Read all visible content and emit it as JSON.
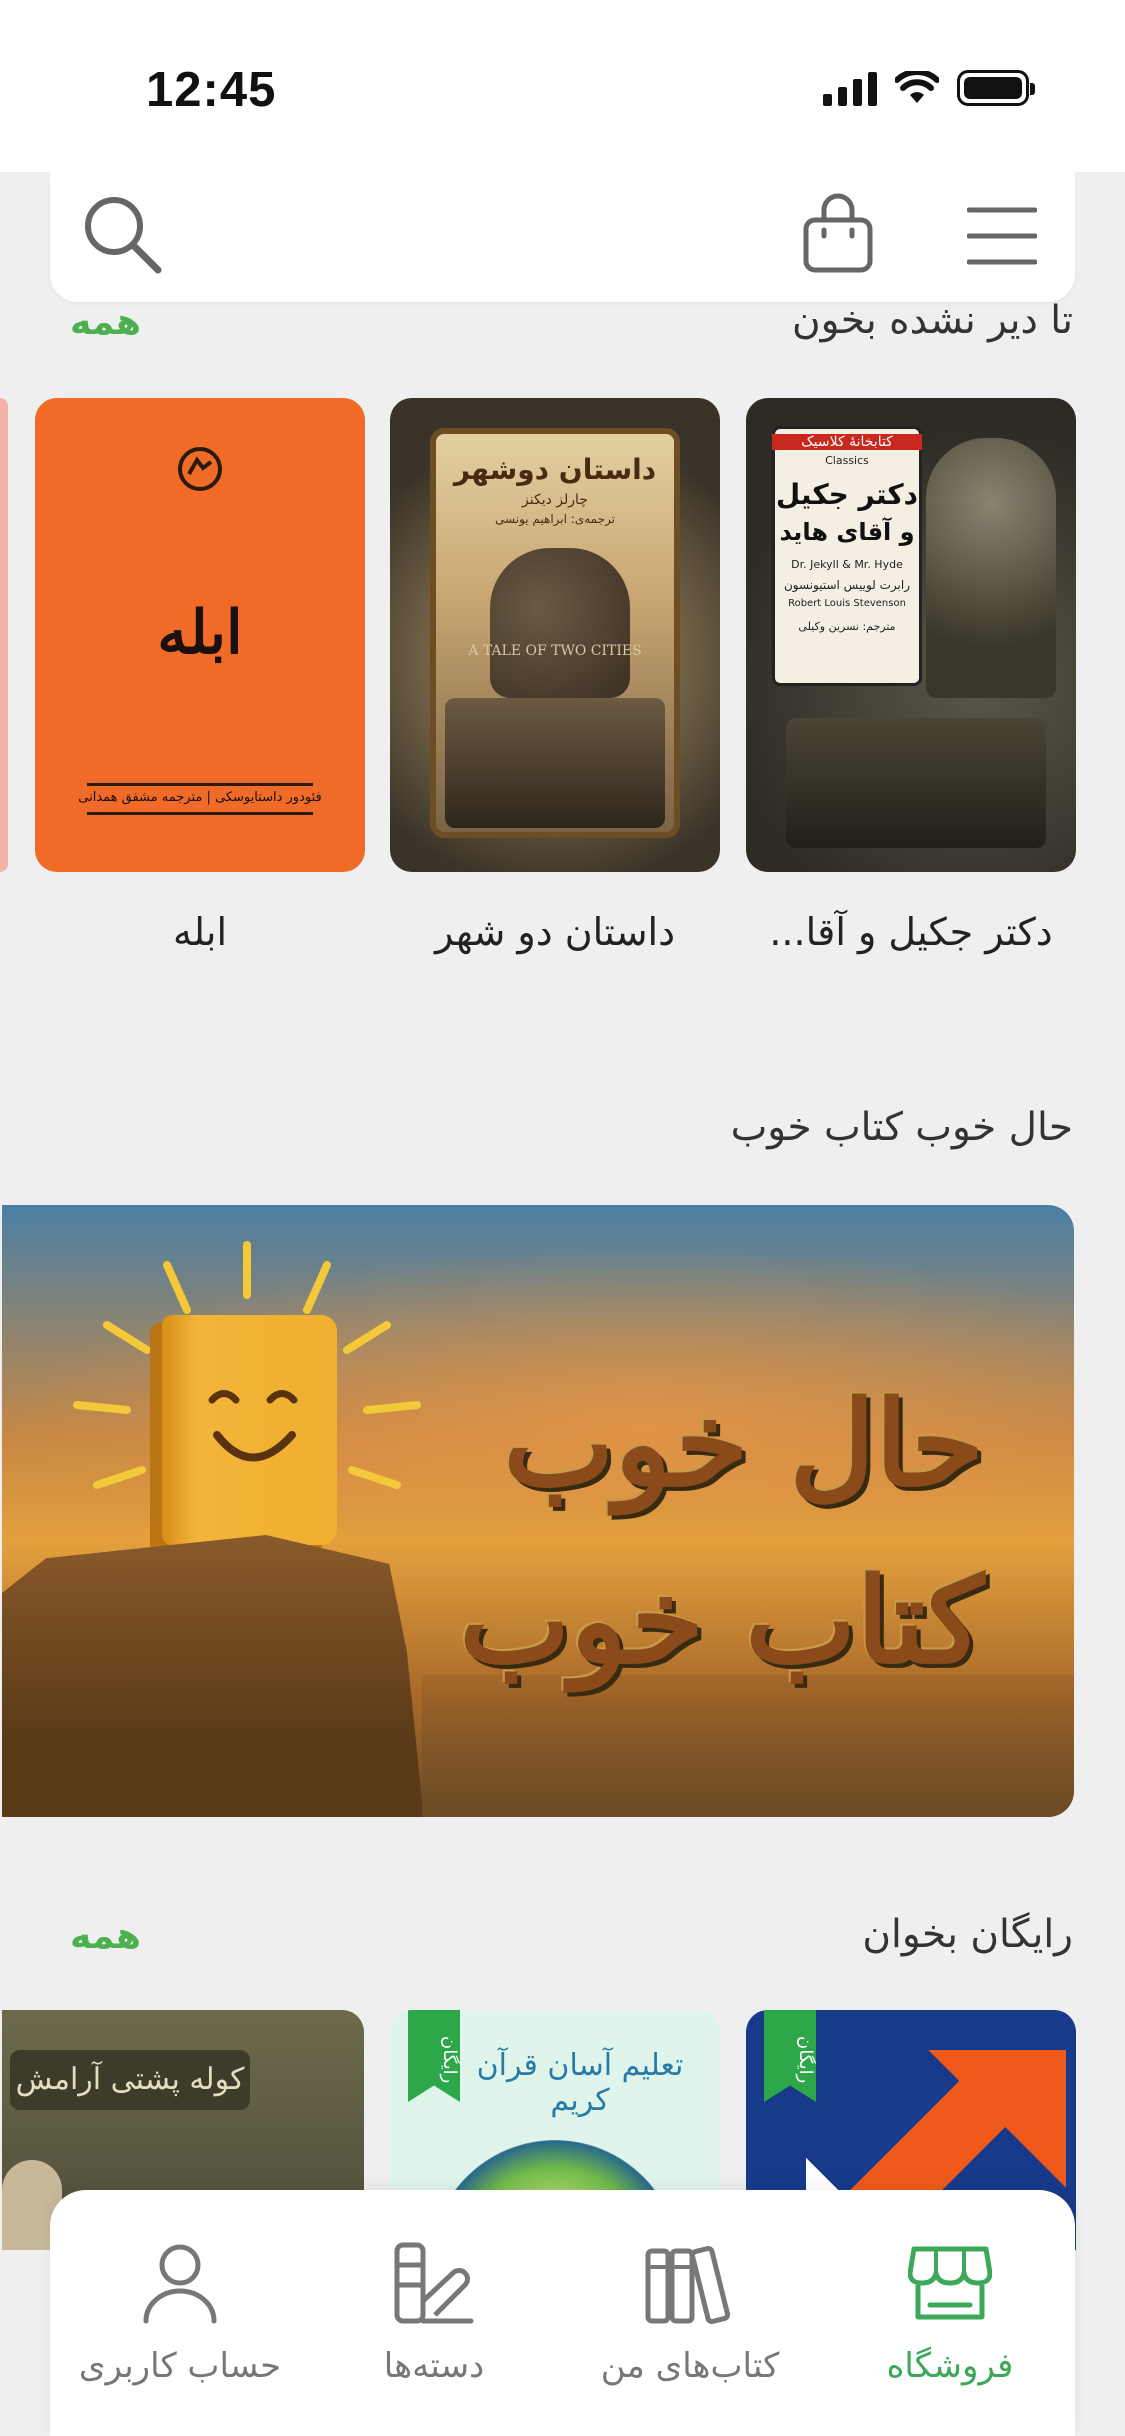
{
  "status": {
    "time": "12:45"
  },
  "sections": {
    "before_late": {
      "title": "تا دیر نشده بخون",
      "see_all": "همه",
      "books": [
        {
          "title": "دکتر جکیل و آقا...",
          "cover_lines": [
            "کتابخانهٔ کلاسیک",
            "Classics",
            "دکتر جکیل",
            "و آقای هاید",
            "Dr. Jekyll & Mr. Hyde",
            "رابرت لوییس استیونسون",
            "Robert Louis Stevenson",
            "مترجم: نسرین وکیلی"
          ]
        },
        {
          "title": "داستان دو شهر",
          "cover_lines": [
            "داستان دوشهر",
            "چارلز دیکنز",
            "ترجمه‌ی: ابراهیم یونسی",
            "A TALE OF TWO CITIES"
          ]
        },
        {
          "title": "ابله",
          "cover_lines": [
            "ابله",
            "فئودور داستایوسکی | مترجمه مشفق همدانی"
          ]
        }
      ]
    },
    "good_mood": {
      "title": "حال خوب کتاب خوب",
      "banner_line1": "حال خوب",
      "banner_line2": "کتاب خوب"
    },
    "free": {
      "title": "رایگان بخوان",
      "see_all": "همه",
      "tag": "رایگان",
      "books": [
        {
          "cover_text": ""
        },
        {
          "cover_text": "تعلیم آسان قرآن کریم"
        },
        {
          "cover_text": "کوله پشتی آرامش"
        }
      ]
    }
  },
  "nav": {
    "items": [
      {
        "label": "فروشگاه",
        "icon": "store-icon",
        "active": true
      },
      {
        "label": "کتاب‌های من",
        "icon": "books-icon",
        "active": false
      },
      {
        "label": "دسته‌ها",
        "icon": "categories-icon",
        "active": false
      },
      {
        "label": "حساب کاربری",
        "icon": "user-icon",
        "active": false
      }
    ]
  },
  "colors": {
    "accent": "#3ea85a",
    "background": "#efefef",
    "card": "#ffffff"
  }
}
